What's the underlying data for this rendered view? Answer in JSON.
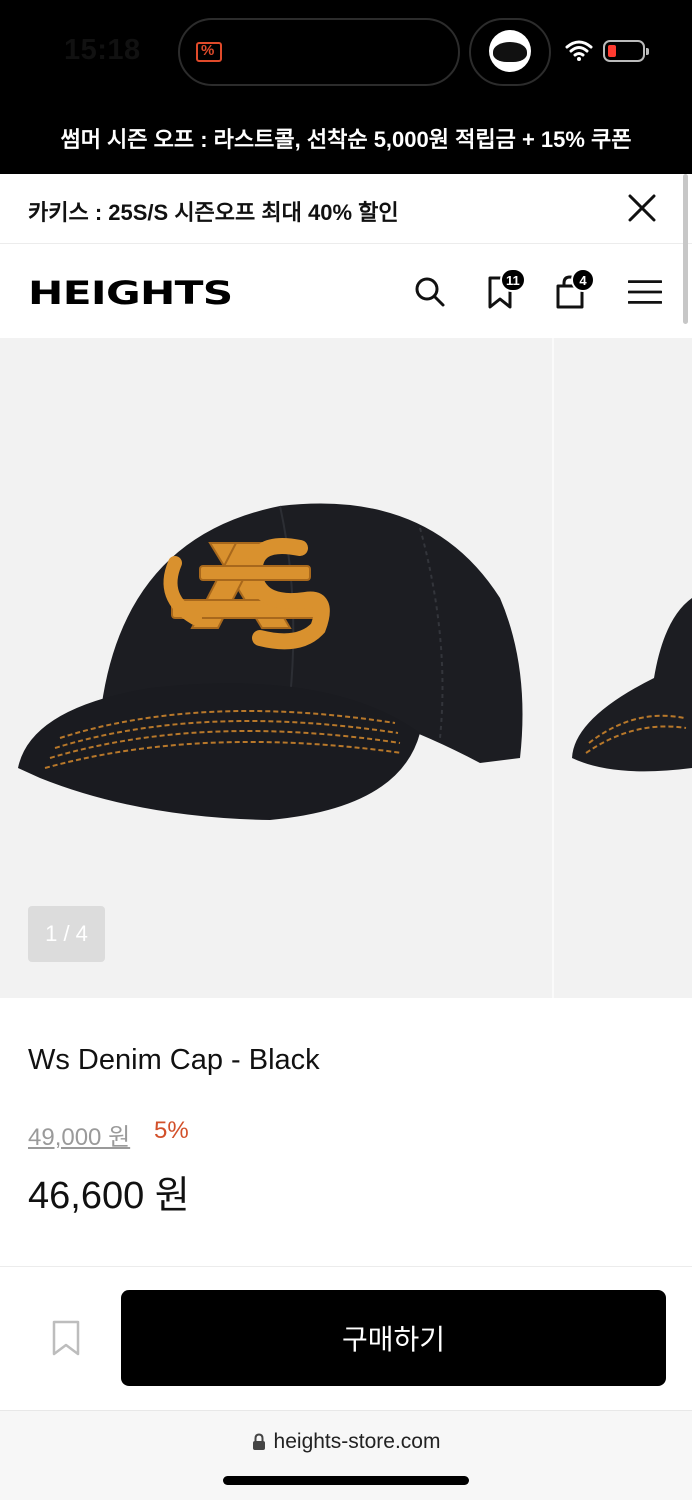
{
  "status_bar": {
    "time": "15:18"
  },
  "promo_banner": {
    "text": "썸머 시즌 오프 : 라스트콜, 선착순 5,000원 적립금 + 15% 쿠폰"
  },
  "notice": {
    "text": "카키스 : 25S/S 시즌오프 최대 40% 할인"
  },
  "header": {
    "logo": "HEIGHTS",
    "wishlist_count": "11",
    "cart_count": "4"
  },
  "gallery": {
    "counter": "1 / 4"
  },
  "product": {
    "name": "Ws Denim Cap - Black",
    "original_price": "49,000 원",
    "discount": "5%",
    "sale_price": "46,600 원"
  },
  "buy_bar": {
    "buy_label": "구매하기"
  },
  "browser": {
    "url": "heights-store.com"
  },
  "colors": {
    "accent_discount": "#d2502a",
    "cap_embroidery": "#d9912e",
    "cap_body": "#1c1d22"
  },
  "icons": [
    "search-icon",
    "bookmark-icon",
    "shopping-bag-icon",
    "menu-icon",
    "close-icon",
    "lock-icon",
    "wifi-icon",
    "battery-icon"
  ]
}
